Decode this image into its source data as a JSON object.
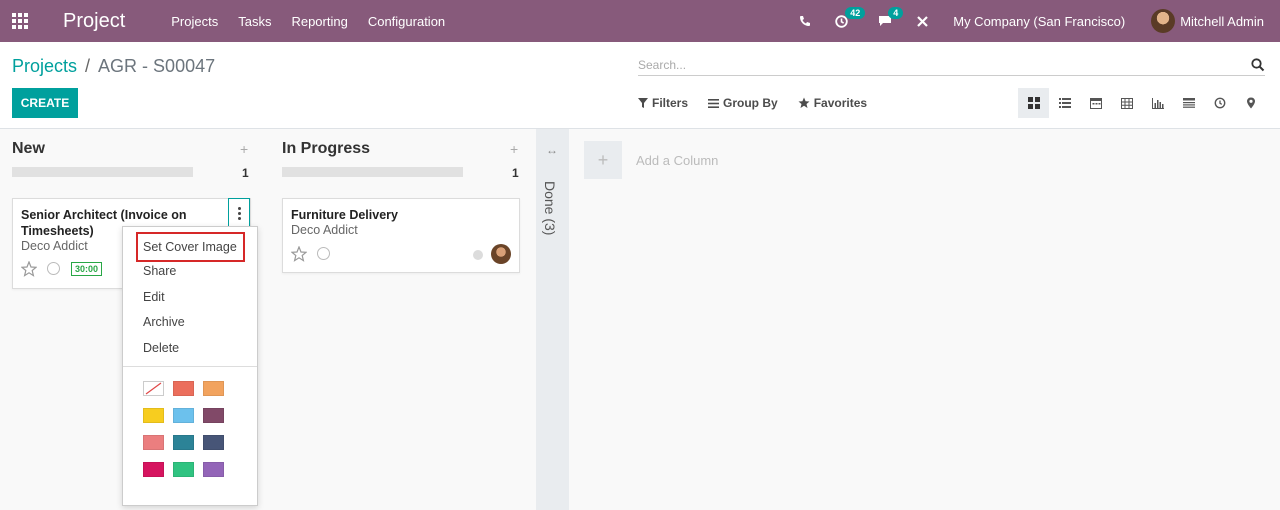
{
  "navbar": {
    "app_name": "Project",
    "menu": [
      "Projects",
      "Tasks",
      "Reporting",
      "Configuration"
    ],
    "activity_count": "42",
    "messages_count": "4",
    "company": "My Company (San Francisco)",
    "user": "Mitchell Admin"
  },
  "breadcrumb": {
    "parent": "Projects",
    "separator": "/",
    "current": "AGR - S00047"
  },
  "create_label": "CREATE",
  "search": {
    "placeholder": "Search..."
  },
  "filters": {
    "filters_label": "Filters",
    "group_by_label": "Group By",
    "favorites_label": "Favorites"
  },
  "views": [
    "kanban-view",
    "list-view",
    "calendar-view",
    "pivot-view",
    "graph-view",
    "activity-view",
    "timesheet-view",
    "map-view"
  ],
  "columns": [
    {
      "title": "New",
      "count": "1",
      "card": {
        "title": "Senior Architect (Invoice on Timesheets)",
        "customer": "Deco Addict",
        "time": "30:00"
      }
    },
    {
      "title": "In Progress",
      "count": "1",
      "card": {
        "title": "Furniture Delivery",
        "customer": "Deco Addict"
      }
    }
  ],
  "folded_column": {
    "label": "Done (3)"
  },
  "add_column_label": "Add a Column",
  "dropdown": {
    "items": [
      "Set Cover Image",
      "Share",
      "Edit",
      "Archive",
      "Delete"
    ],
    "colors": [
      "#ffffff",
      "#eb6e5c",
      "#f2a35e",
      "#f7cd1f",
      "#6cc1ed",
      "#814968",
      "#eb7e7f",
      "#2c8397",
      "#475577",
      "#d6145f",
      "#30c381",
      "#9365b8"
    ]
  }
}
